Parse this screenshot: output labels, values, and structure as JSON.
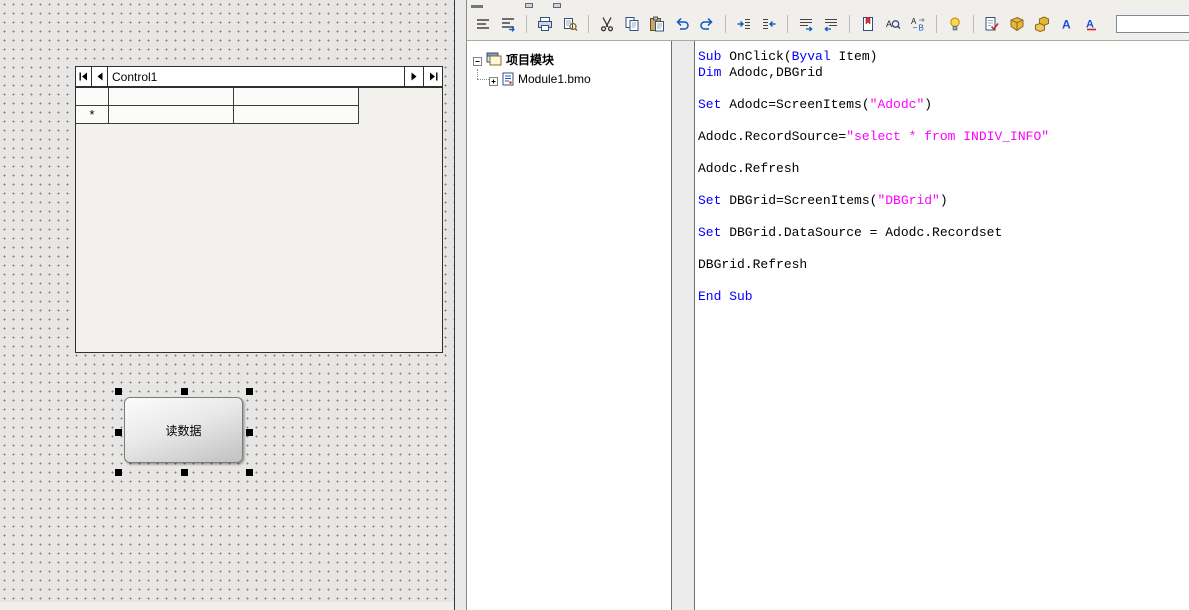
{
  "designer": {
    "adodc": {
      "caption": "Control1"
    },
    "grid": {
      "row_marker": "*"
    },
    "read_button": {
      "label": "读数据"
    }
  },
  "tree": {
    "root_label": "项目模块",
    "child_label": "Module1.bmo"
  },
  "toolbar": {
    "combo_value": "",
    "icons": [
      "lines-icon",
      "lines-arrow-icon",
      "print-icon",
      "print-preview-icon",
      "cut-icon",
      "copy-icon",
      "paste-icon",
      "undo-icon",
      "redo-icon",
      "indent-increase-icon",
      "indent-decrease-icon",
      "shift-right-icon",
      "shift-left-icon",
      "bookmark-icon",
      "find-icon",
      "find-replace-icon",
      "lamp-icon",
      "syntax-check-icon",
      "compile-icon",
      "compile-all-icon",
      "font-icon",
      "font-style-icon",
      "refresh-icon"
    ]
  },
  "code": {
    "lines": [
      [
        {
          "t": "Sub",
          "c": "k"
        },
        {
          "t": " OnClick(",
          "c": "p"
        },
        {
          "t": "Byval",
          "c": "k"
        },
        {
          "t": " Item)",
          "c": "p"
        }
      ],
      [
        {
          "t": "Dim",
          "c": "k"
        },
        {
          "t": " Adodc,DBGrid",
          "c": "p"
        }
      ],
      [],
      [
        {
          "t": "Set",
          "c": "k"
        },
        {
          "t": " Adodc=ScreenItems(",
          "c": "p"
        },
        {
          "t": "\"Adodc\"",
          "c": "s"
        },
        {
          "t": ")",
          "c": "p"
        }
      ],
      [],
      [
        {
          "t": "Adodc.RecordSource=",
          "c": "p"
        },
        {
          "t": "\"select * from INDIV_INFO\"",
          "c": "s"
        }
      ],
      [],
      [
        {
          "t": "Adodc.Refresh",
          "c": "p"
        }
      ],
      [],
      [
        {
          "t": "Set",
          "c": "k"
        },
        {
          "t": " DBGrid=ScreenItems(",
          "c": "p"
        },
        {
          "t": "\"DBGrid\"",
          "c": "s"
        },
        {
          "t": ")",
          "c": "p"
        }
      ],
      [],
      [
        {
          "t": "Set",
          "c": "k"
        },
        {
          "t": " DBGrid.DataSource = Adodc.Recordset",
          "c": "p"
        }
      ],
      [],
      [
        {
          "t": "DBGrid.Refresh",
          "c": "p"
        }
      ],
      [],
      [
        {
          "t": "End Sub",
          "c": "k"
        }
      ]
    ]
  },
  "colors": {
    "kw": "#0000ff",
    "str": "#ff00ff"
  }
}
